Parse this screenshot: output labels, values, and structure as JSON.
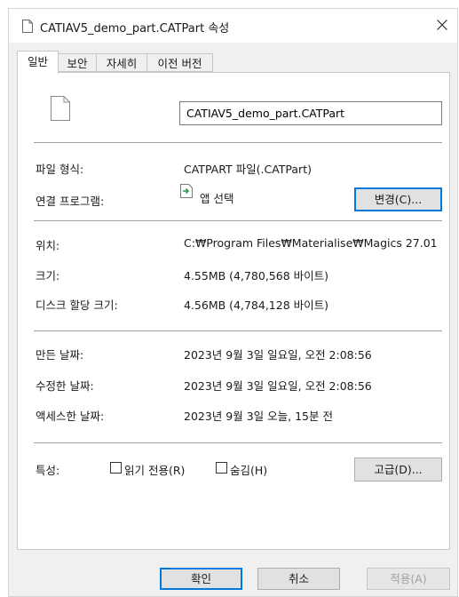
{
  "window": {
    "title": "CATIAV5_demo_part.CATPart 속성"
  },
  "tabs": [
    {
      "label": "일반",
      "active": true
    },
    {
      "label": "보안",
      "active": false
    },
    {
      "label": "자세히",
      "active": false
    },
    {
      "label": "이전 버전",
      "active": false
    }
  ],
  "general": {
    "file_name": "CATIAV5_demo_part.CATPart",
    "file_type_label": "파일 형식:",
    "file_type_value": "CATPART 파일(.CATPart)",
    "opens_with_label": "연결 프로그램:",
    "opens_with_value": "앱 선택",
    "change_button": "변경(C)...",
    "location_label": "위치:",
    "location_value": "C:₩Program Files₩Materialise₩Magics 27.01",
    "size_label": "크기:",
    "size_value": "4.55MB (4,780,568 바이트)",
    "size_on_disk_label": "디스크 할당 크기:",
    "size_on_disk_value": "4.56MB (4,784,128 바이트)",
    "created_label": "만든 날짜:",
    "created_value": "2023년 9월 3일 일요일, 오전 2:08:56",
    "modified_label": "수정한 날짜:",
    "modified_value": "2023년 9월 3일 일요일, 오전 2:08:56",
    "accessed_label": "액세스한 날짜:",
    "accessed_value": "2023년 9월 3일 오늘, 15분 전",
    "attributes_label": "특성:",
    "readonly_label": "읽기 전용(R)",
    "readonly_checked": false,
    "hidden_label": "숨김(H)",
    "hidden_checked": false,
    "advanced_button": "고급(D)..."
  },
  "footer": {
    "ok": "확인",
    "cancel": "취소",
    "apply": "적용(A)"
  },
  "icons": {
    "title": "file-icon",
    "close": "close-icon",
    "file_large": "file-icon",
    "program": "app-select-icon"
  }
}
